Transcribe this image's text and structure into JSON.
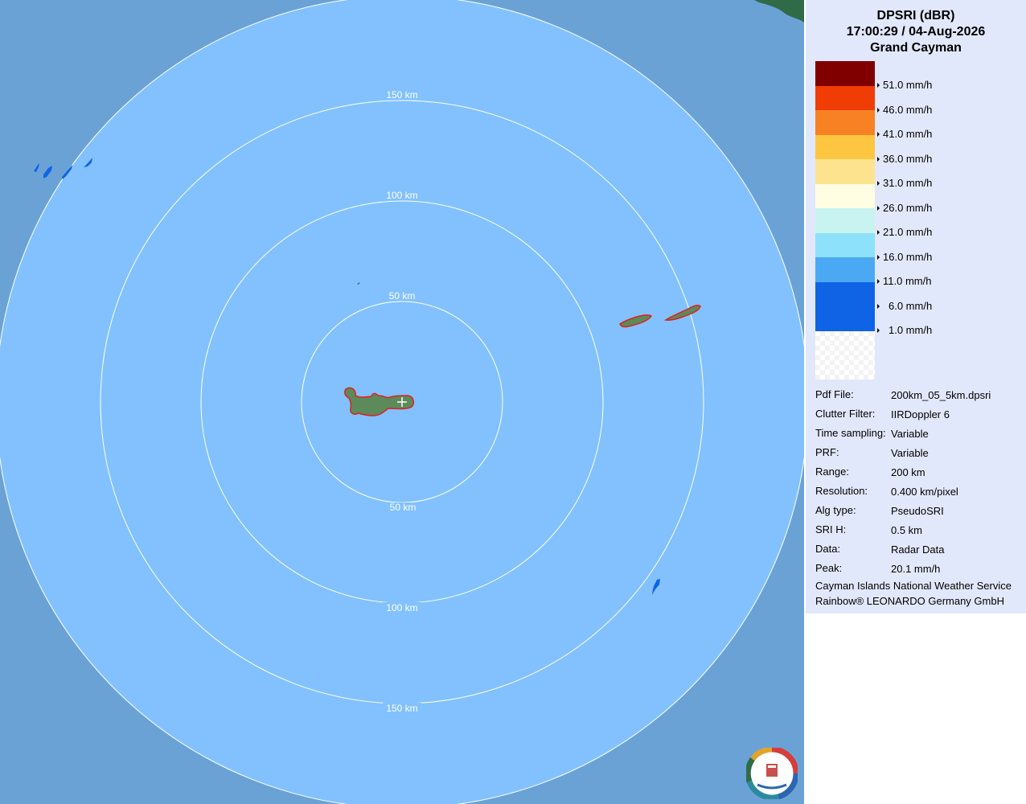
{
  "header": {
    "product": "DPSRI (dBR)",
    "datetime": "17:00:29 / 04-Aug-2026",
    "site": "Grand Cayman"
  },
  "legend": [
    {
      "color": "#800000",
      "label": "51.0 mm/h"
    },
    {
      "color": "#f03c05",
      "label": "46.0 mm/h"
    },
    {
      "color": "#f88123",
      "label": "41.0 mm/h"
    },
    {
      "color": "#fec640",
      "label": "36.0 mm/h"
    },
    {
      "color": "#fee38f",
      "label": "31.0 mm/h"
    },
    {
      "color": "#fffee3",
      "label": "26.0 mm/h"
    },
    {
      "color": "#c8f3f0",
      "label": "21.0 mm/h"
    },
    {
      "color": "#8de1fa",
      "label": "16.0 mm/h"
    },
    {
      "color": "#4ba9f3",
      "label": "11.0 mm/h"
    },
    {
      "color": "#0f64e6",
      "label": "6.0 mm/h"
    },
    {
      "color": "#0f64e6",
      "label": "1.0 mm/h"
    }
  ],
  "metadata": [
    {
      "key": "Pdf File:",
      "value": "200km_05_5km.dpsri"
    },
    {
      "key": "Clutter Filter:",
      "value": "IIRDoppler 6"
    },
    {
      "key": "Time sampling:",
      "value": "Variable"
    },
    {
      "key": "PRF:",
      "value": "Variable"
    },
    {
      "key": "Range:",
      "value": "200 km"
    },
    {
      "key": "Resolution:",
      "value": "0.400 km/pixel"
    },
    {
      "key": "Alg type:",
      "value": "PseudoSRI"
    },
    {
      "key": "SRI H:",
      "value": "0.5 km"
    },
    {
      "key": "Data:",
      "value": "Radar Data"
    },
    {
      "key": "Peak:",
      "value": "20.1 mm/h"
    }
  ],
  "footer": {
    "line1": "Cayman Islands National Weather Service",
    "line2": "Rainbow® LEONARDO Germany GmbH"
  },
  "range_rings": {
    "label_50_top": "50 km",
    "label_50_bottom": "50 km",
    "label_100_top": "100 km",
    "label_100_bottom": "100 km",
    "label_150_top": "150 km",
    "label_150_bottom": "150 km"
  },
  "colors": {
    "coverage": "#82c1fd",
    "outside": "#6ba2d6",
    "panel": "#e2e8fb",
    "land": "#5d8a5a",
    "coast": "#e02020",
    "echo": "#0f64e6"
  },
  "icons": {
    "radar_center": "crosshair-icon",
    "logo": "cayman-nws-logo-icon"
  }
}
